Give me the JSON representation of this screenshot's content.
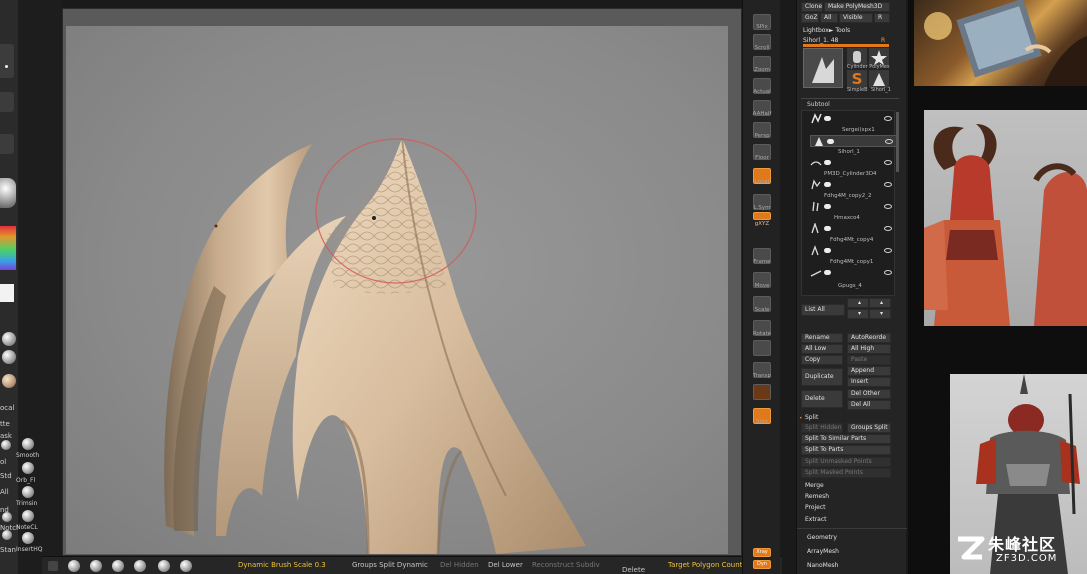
{
  "left_strip": {
    "labels": {
      "local": "ocal",
      "matte": "tte",
      "ask": "ask",
      "smooth": "Smooth",
      "orb": "Orb_Fl",
      "trim": "Trimsin",
      "std": "Std",
      "ol": "ol",
      "all": "All",
      "nd": "nd",
      "notch": "Notch",
      "notch2": "NoteCL",
      "stan": "Stan",
      "insert": "InsertHQ"
    }
  },
  "bottom_bar": {
    "dynamic_brush_scale": "Dynamic  Brush  Scale  0.3",
    "groups_split_dynamic": "Groups  Split  Dynamic",
    "del_hidden": "Del Hidden",
    "del_lower": "Del Lower",
    "reconstruct": "Reconstruct Subdiv",
    "delete": "Delete",
    "target_polygon_count": "Target  Polygon  Count"
  },
  "right_shelf": {
    "items": [
      "SPix",
      "Scroll",
      "Zoom",
      "Actual",
      "AAHalf",
      "Persp",
      "Floor",
      "Local",
      "L.Sym",
      "gXYZ",
      "",
      "Frame",
      "Move",
      "Scale",
      "Rotate",
      "",
      "Transp",
      "",
      "Solo"
    ],
    "bottom": [
      "Xray",
      "Dyn"
    ]
  },
  "panel": {
    "top_buttons": [
      "Clone",
      "Make PolyMesh3D",
      "GoZ",
      "All",
      "Visible",
      "R"
    ],
    "lightbox_tools": "Lightbox► Tools",
    "current_tool": "Sihorl_1. 48",
    "r_label": "R",
    "tool_thumbs": [
      "Cylinder PolyMes",
      "SimpleB",
      "Sihorl_1"
    ],
    "subtool_header": "Subtool",
    "subtools": [
      "Sergei(spx1",
      "Sihorl_1",
      "PM3D_Cylinder3D4",
      "Fdhg4M_copy2_2",
      "Hmaxco4",
      "Fdhg4Mt_copy4",
      "Fdhg4Mt_copy1",
      "Gpugs_4"
    ],
    "list_all": "List All",
    "buttons": {
      "rename": "Rename",
      "autoreorder": "AutoReorde",
      "all_low": "All Low",
      "all_high": "All High",
      "copy": "Copy",
      "paste": "Paste",
      "duplicate": "Duplicate",
      "append": "Append",
      "insert": "Insert",
      "delete": "Delete",
      "del_other": "Del Other",
      "del_all": "Del All",
      "split": "Split",
      "split_hidden": "Split Hidden",
      "groups_split": "Groups Split",
      "split_similar": "Split To Similar Parts",
      "split_parts": "Split To Parts",
      "split_unmasked": "Split Unmasked Points",
      "split_masked": "Split Masked Points",
      "merge": "Merge",
      "remesh": "Remesh",
      "project": "Project",
      "extract": "Extract",
      "geometry": "Geometry",
      "arraymesh": "ArrayMesh",
      "nanomesh": "NanoMesh"
    }
  },
  "watermark": {
    "cn": "朱峰社区",
    "url": "ZF3D.COM"
  },
  "colors": {
    "accent_orange": "#e0781c",
    "clay": "#d8bfa2",
    "brush_ring": "#d05a5a"
  }
}
